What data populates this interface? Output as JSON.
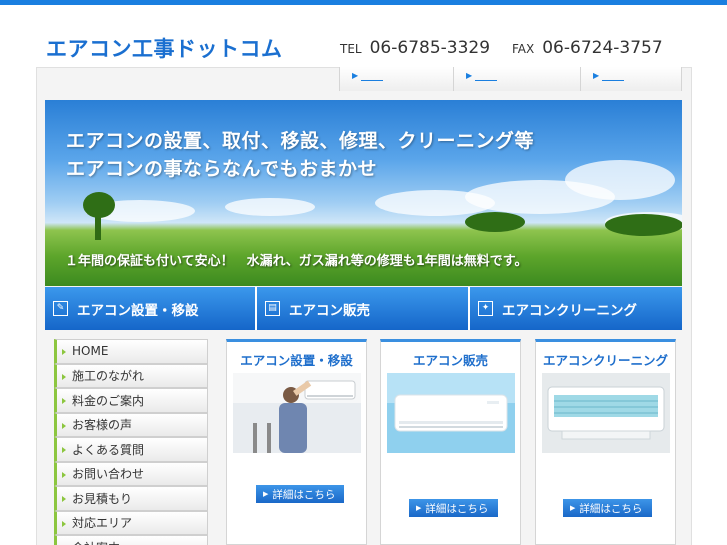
{
  "header": {
    "logo": "エアコン工事ドットコム",
    "tel_label": "TEL",
    "tel_number": "06-6785-3329",
    "fax_label": "FAX",
    "fax_number": "06-6724-3757"
  },
  "top_nav": [
    {
      "arrow": "▶"
    },
    {
      "arrow": "▶"
    },
    {
      "arrow": "▶"
    }
  ],
  "hero": {
    "line1": "エアコンの設置、取付、移設、修理、クリーニング等",
    "line2": "エアコンの事ならなんでもおまかせ",
    "subline": "１年間の保証も付いて安心！　水漏れ、ガス漏れ等の修理も1年間は無料です。"
  },
  "service_bar": [
    {
      "label": "エアコン設置・移設",
      "icon": "wrench-icon",
      "glyph": "✎"
    },
    {
      "label": "エアコン販売",
      "icon": "register-icon",
      "glyph": "▤"
    },
    {
      "label": "エアコンクリーニング",
      "icon": "sparkle-icon",
      "glyph": "✦"
    }
  ],
  "sidebar": {
    "items": [
      {
        "label": "HOME"
      },
      {
        "label": "施工のながれ"
      },
      {
        "label": "料金のご案内"
      },
      {
        "label": "お客様の声"
      },
      {
        "label": "よくある質問"
      },
      {
        "label": "お問い合わせ"
      },
      {
        "label": "お見積もり"
      },
      {
        "label": "対応エリア"
      },
      {
        "label": "会社案内"
      }
    ]
  },
  "cards": [
    {
      "title": "エアコン設置・移設",
      "button": "詳細はこちら",
      "image": "installation-photo"
    },
    {
      "title": "エアコン販売",
      "button": "詳細はこちら",
      "image": "air-conditioner-photo"
    },
    {
      "title": "エアコンクリーニング",
      "button": "詳細はこちら",
      "image": "cleaning-photo"
    }
  ],
  "colors": {
    "accent": "#1a7fe0",
    "sidebar_marker": "#8cc63f",
    "card_title": "#1f6fcc"
  }
}
